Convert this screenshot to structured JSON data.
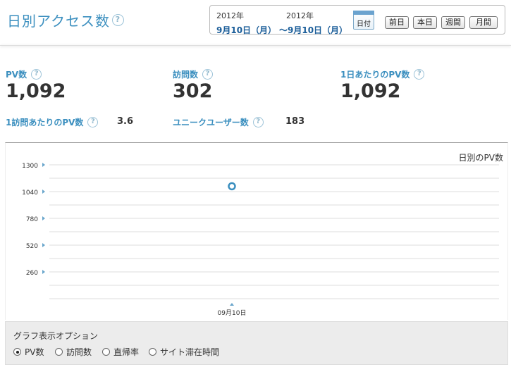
{
  "header": {
    "title": "日別アクセス数",
    "help_glyph": "?",
    "date_range": {
      "start_year": "2012年",
      "start_date": "9月10日（月）",
      "end_year": "2012年",
      "end_date": "～9月10日（月）",
      "calendar_label": "日付"
    },
    "nav_buttons": [
      "前日",
      "本日",
      "週間",
      "月間"
    ]
  },
  "stats": {
    "pv": {
      "label": "PV数",
      "value": "1,092"
    },
    "visits": {
      "label": "訪問数",
      "value": "302"
    },
    "pv_per_day": {
      "label": "1日あたりのPV数",
      "value": "1,092"
    },
    "pv_per_visit": {
      "label": "1訪問あたりのPV数",
      "value": "3.6"
    },
    "unique_users": {
      "label": "ユニークユーザー数",
      "value": "183"
    }
  },
  "chart_data": {
    "type": "line",
    "title": "日別のPV数",
    "categories": [
      "09月10日"
    ],
    "values": [
      1092
    ],
    "y_ticks": [
      "1300",
      "1040",
      "780",
      "520",
      "260"
    ],
    "ylim": [
      0,
      1300
    ],
    "grid": true,
    "colors": {
      "marker": "#3b8fbf",
      "grid": "#dddddd",
      "axis_arrow": "#6aa6cc"
    }
  },
  "options": {
    "title": "グラフ表示オプション",
    "items": [
      "PV数",
      "訪問数",
      "直帰率",
      "サイト滞在時間"
    ],
    "selected": 0
  }
}
